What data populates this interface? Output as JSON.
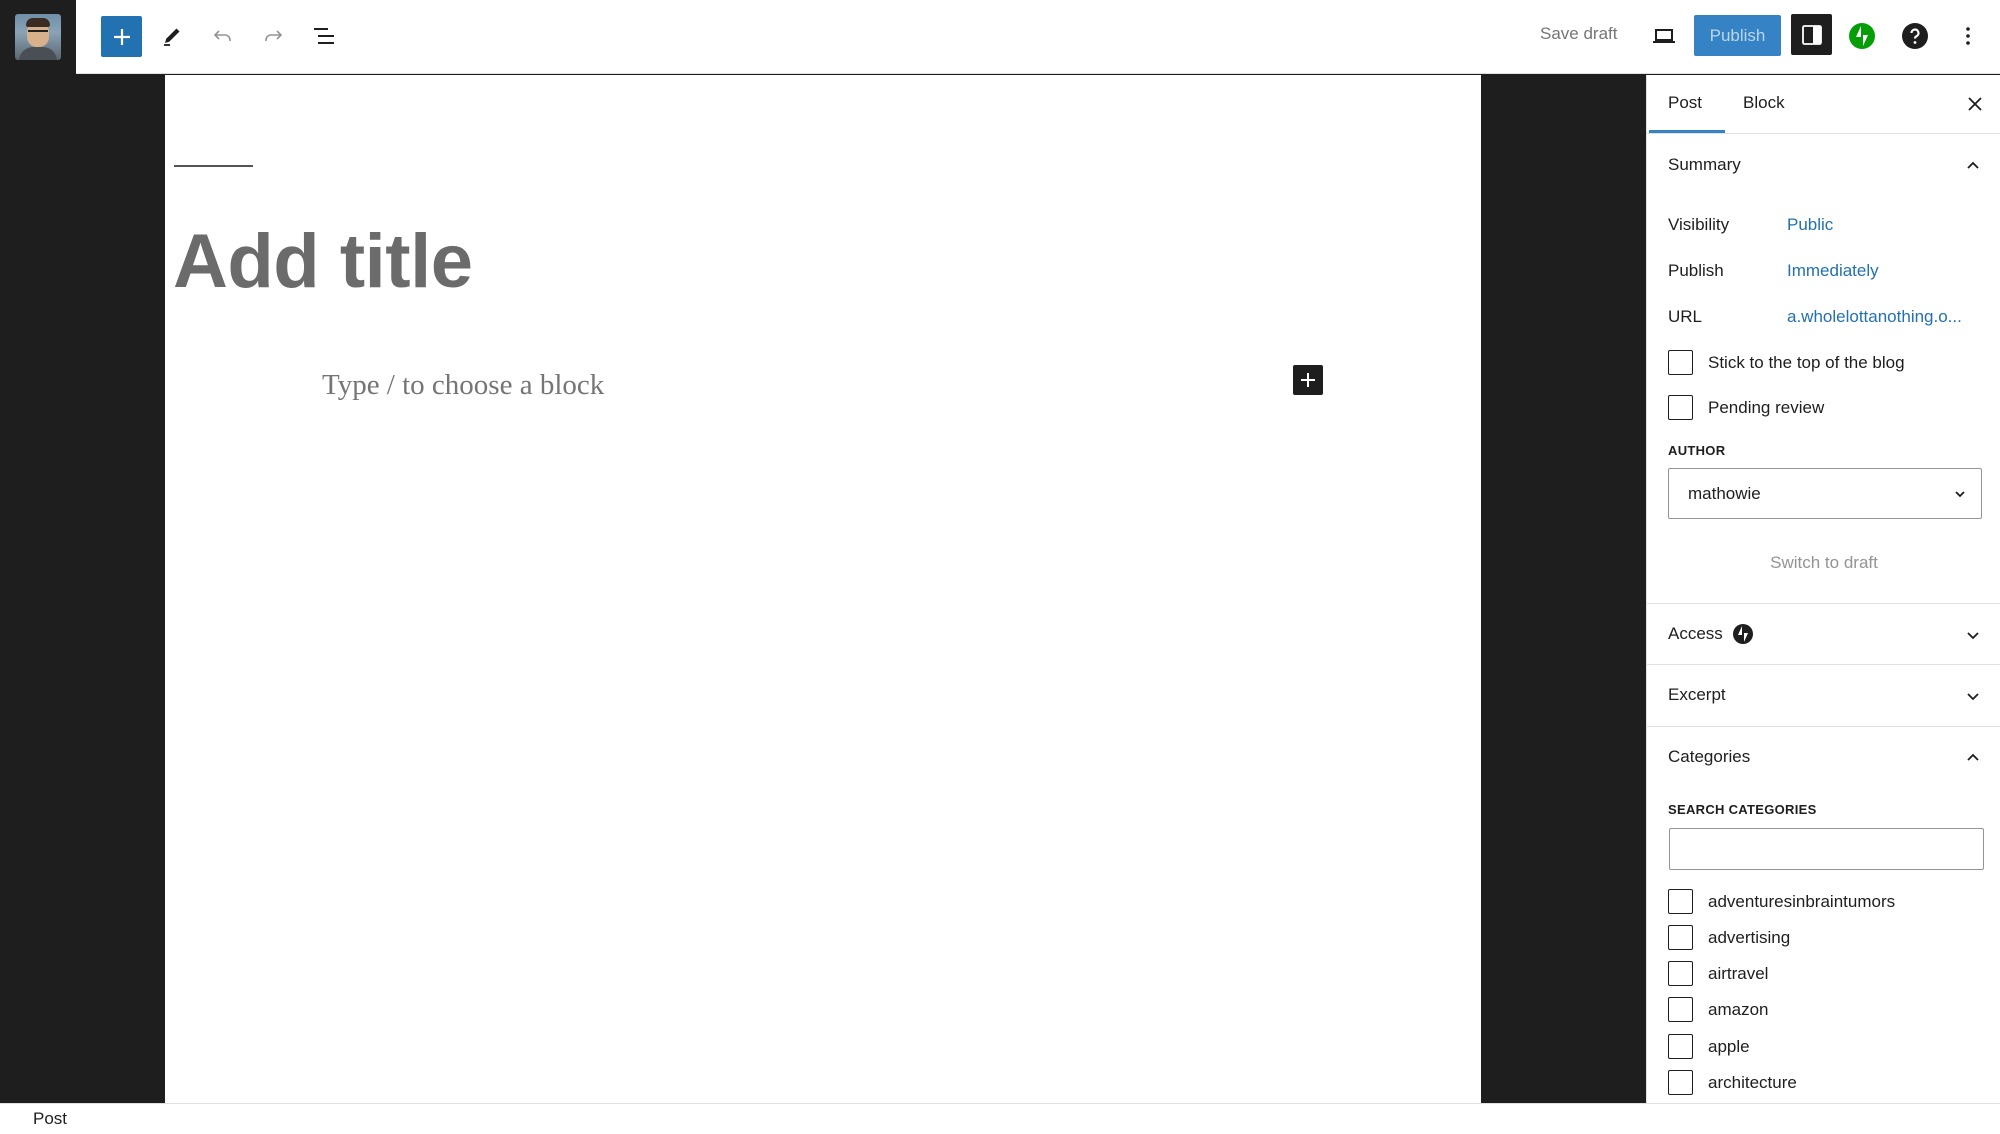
{
  "toolbar": {
    "add_block_icon": "plus-icon",
    "tools_icon": "pencil-icon",
    "undo_icon": "undo-icon",
    "redo_icon": "redo-icon",
    "list_view_icon": "list-view-icon",
    "save_draft_label": "Save draft",
    "preview_icon": "laptop-icon",
    "publish_label": "Publish",
    "settings_icon": "sidebar-toggle-icon",
    "jetpack_icon": "jetpack-bolt-icon",
    "help_icon": "help-icon",
    "more_icon": "vertical-ellipsis-icon",
    "accent_color": "#3582c4",
    "jetpack_color": "#069e08"
  },
  "editor": {
    "title_placeholder": "Add title",
    "block_placeholder": "Type / to choose a block",
    "inserter_icon": "plus-icon"
  },
  "sidebar": {
    "tabs": [
      {
        "label": "Post",
        "active": true
      },
      {
        "label": "Block",
        "active": false
      }
    ],
    "close_icon": "close-icon",
    "summary": {
      "heading": "Summary",
      "expanded": true,
      "rows": [
        {
          "label": "Visibility",
          "value": "Public"
        },
        {
          "label": "Publish",
          "value": "Immediately"
        },
        {
          "label": "URL",
          "value": "a.wholelottanothing.o..."
        }
      ],
      "checkboxes": [
        {
          "label": "Stick to the top of the blog",
          "checked": false
        },
        {
          "label": "Pending review",
          "checked": false
        }
      ],
      "author_label": "AUTHOR",
      "author_value": "mathowie",
      "switch_to_draft": "Switch to draft"
    },
    "access": {
      "heading": "Access",
      "expanded": false,
      "icon": "jetpack-bolt-icon"
    },
    "excerpt": {
      "heading": "Excerpt",
      "expanded": false
    },
    "categories": {
      "heading": "Categories",
      "expanded": true,
      "search_label": "SEARCH CATEGORIES",
      "search_value": "",
      "items": [
        {
          "label": "adventuresinbraintumors",
          "checked": false
        },
        {
          "label": "advertising",
          "checked": false
        },
        {
          "label": "airtravel",
          "checked": false
        },
        {
          "label": "amazon",
          "checked": false
        },
        {
          "label": "apple",
          "checked": false
        },
        {
          "label": "architecture",
          "checked": false
        }
      ]
    }
  },
  "statusbar": {
    "breadcrumb": "Post"
  }
}
